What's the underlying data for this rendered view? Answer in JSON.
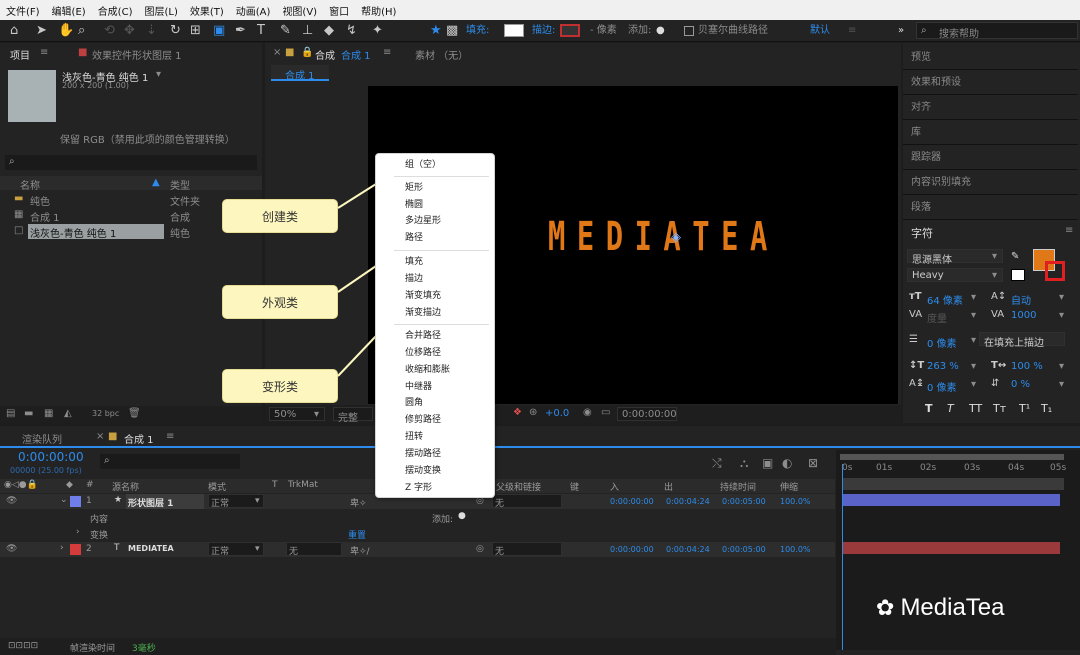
{
  "menubar": {
    "items": [
      "文件(F)",
      "编辑(E)",
      "合成(C)",
      "图层(L)",
      "效果(T)",
      "动画(A)",
      "视图(V)",
      "窗口",
      "帮助(H)"
    ]
  },
  "toolbar": {
    "fill_label": "填充:",
    "stroke_label": "描边:",
    "pixel_label": "- 像素",
    "add_label": "添加:",
    "bezier_label": "贝塞尔曲线路径",
    "default_label": "默认",
    "search_placeholder": "搜索帮助"
  },
  "project": {
    "tab": "项目",
    "effects_tab": "效果控件形状图层 1",
    "item_name": "浅灰色-青色 纯色 1",
    "item_info": "200 x 200 (1.00)",
    "color_note": "保留 RGB（禁用此项的颜色管理转换）",
    "col_name": "名称",
    "col_type": "类型",
    "rows": [
      {
        "name": "纯色",
        "type": "文件夹"
      },
      {
        "name": "合成 1",
        "type": "合成"
      },
      {
        "name": "浅灰色-青色 纯色 1",
        "type": "纯色"
      }
    ],
    "bpc": "32 bpc"
  },
  "viewer": {
    "comp_tab_prefix": "合成",
    "comp_tab_name": "合成 1",
    "footage_tab": "素材 （无）",
    "breadcrumb": "合成 1",
    "text": "MEDIATEA",
    "zoom": "50%",
    "quality": "完整",
    "exposure": "+0.0",
    "timecode": "0:00:00:00"
  },
  "callouts": {
    "create": "创建类",
    "appearance": "外观类",
    "transform": "变形类"
  },
  "add_menu": {
    "group": "组（空）",
    "create": [
      "矩形",
      "椭圆",
      "多边星形",
      "路径"
    ],
    "appearance": [
      "填充",
      "描边",
      "渐变填充",
      "渐变描边"
    ],
    "transform": [
      "合并路径",
      "位移路径",
      "收缩和膨胀",
      "中继器",
      "圆角",
      "修剪路径",
      "扭转",
      "摆动路径",
      "摆动变换",
      "Z 字形"
    ]
  },
  "right_panel": {
    "items": [
      "预览",
      "效果和预设",
      "对齐",
      "库",
      "跟踪器",
      "内容识别填充",
      "段落"
    ],
    "char_title": "字符",
    "font": "思源黑体",
    "weight": "Heavy",
    "font_size": "64 像素",
    "leading": "自动",
    "kerning": "度量",
    "tracking": "1000",
    "stroke_width": "0 像素",
    "stroke_mode": "在填充上描边",
    "v_scale": "263 %",
    "h_scale": "100 %",
    "baseline": "0 像素",
    "tsume": "0 %",
    "fill_color": "#e07818",
    "stroke_color": "#e02020",
    "style_buttons": [
      "T",
      "T",
      "TT",
      "Tт",
      "T¹",
      "T₁"
    ]
  },
  "timeline": {
    "render_tab": "渲染队列",
    "comp_tab": "合成 1",
    "timecode": "0:00:00:00",
    "frame_info": "00000 (25.00 fps)",
    "headers": {
      "source": "源名称",
      "mode": "模式",
      "trkmat": "TrkMat",
      "parent": "父级和链接",
      "keys": "键",
      "in": "入",
      "out": "出",
      "duration": "持续时间",
      "stretch": "伸缩"
    },
    "layers": [
      {
        "num": "1",
        "name": "形状图层 1",
        "mode": "正常",
        "trkmat": "",
        "parent": "无",
        "in": "0:00:00:00",
        "out": "0:00:04:24",
        "duration": "0:00:05:00",
        "stretch": "100.0%",
        "color": "#6f7ee8"
      },
      {
        "num": "2",
        "name": "MEDIATEA",
        "mode": "正常",
        "trkmat": "无",
        "parent": "无",
        "in": "0:00:00:00",
        "out": "0:00:04:24",
        "duration": "0:00:05:00",
        "stretch": "100.0%",
        "color": "#d43c3c"
      }
    ],
    "content_label": "内容",
    "add_label": "添加:",
    "transform_label": "变换",
    "reset_label": "重置",
    "ruler": [
      "0s",
      "01s",
      "02s",
      "03s",
      "04s",
      "05s"
    ],
    "footer_label": "帧渲染时间",
    "footer_value": "3毫秒"
  },
  "watermark": "MediaTea"
}
